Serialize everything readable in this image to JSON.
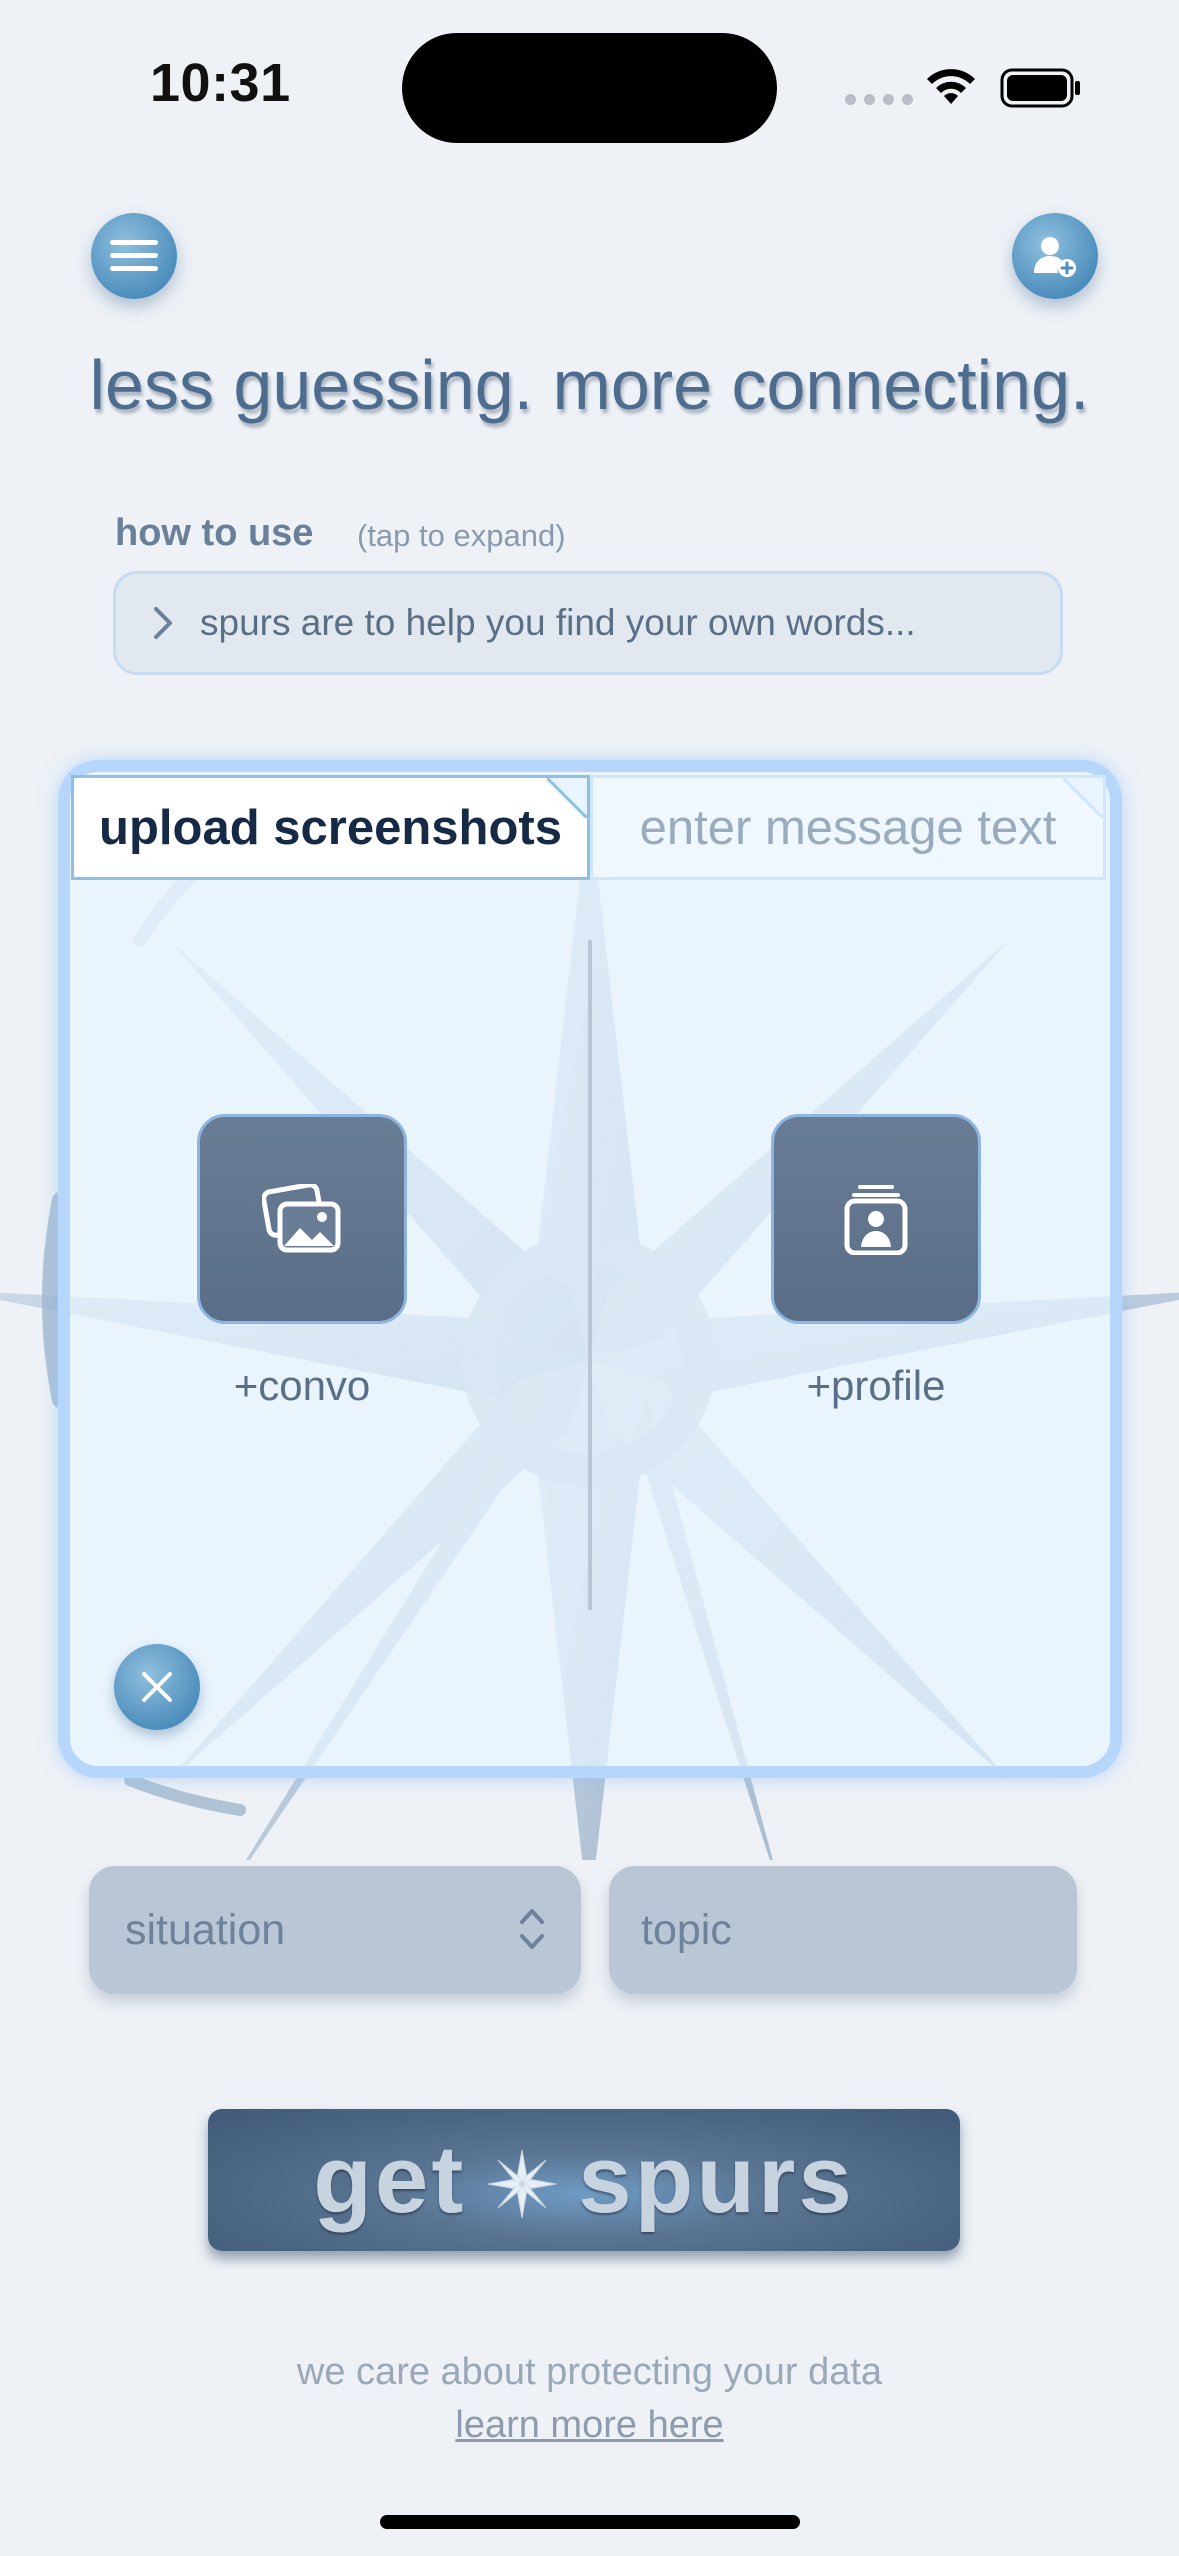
{
  "status_bar": {
    "time": "10:31"
  },
  "header": {
    "headline": "less guessing. more connecting."
  },
  "how_to_use": {
    "title": "how to use",
    "hint": "(tap to expand)",
    "summary": "spurs are to help you find your own words..."
  },
  "tabs": [
    {
      "label": "upload screenshots",
      "selected": true
    },
    {
      "label": "enter message text",
      "selected": false
    }
  ],
  "uploads": {
    "convo_label": "+convo",
    "profile_label": "+profile"
  },
  "selectors": {
    "situation_placeholder": "situation",
    "topic_placeholder": "topic"
  },
  "cta": {
    "get": "get",
    "spurs": "spurs"
  },
  "footer": {
    "privacy_text": "we care about protecting your data",
    "privacy_link": "learn more here"
  },
  "colors": {
    "accent_blue": "#4f8fbd",
    "card_border": "#b7d6fb",
    "cta_background": "#4a6582",
    "background": "#eef2f7"
  },
  "icons": [
    "menu-icon",
    "add-profile-icon",
    "chevron-right-icon",
    "photos-icon",
    "profile-card-icon",
    "close-icon",
    "up-down-chevron-icon",
    "compass-star-icon"
  ]
}
